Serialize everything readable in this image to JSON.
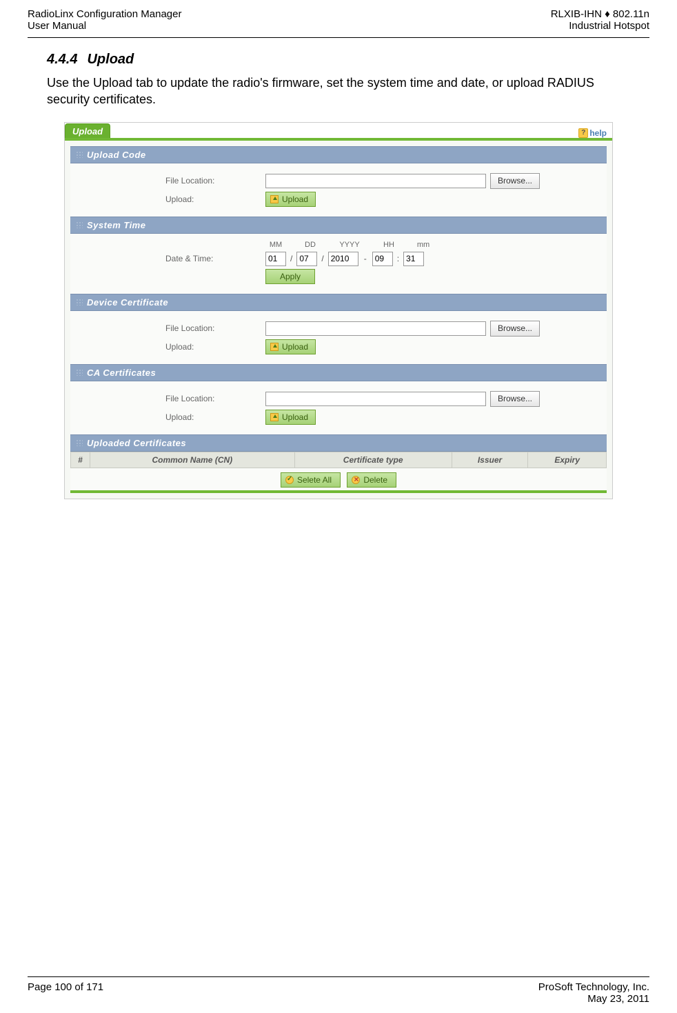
{
  "header": {
    "left_line1": "RadioLinx Configuration Manager",
    "left_line2": "User Manual",
    "right_line1": "RLXIB-IHN ♦ 802.11n",
    "right_line2": "Industrial Hotspot"
  },
  "section": {
    "number": "4.4.4",
    "title": "Upload",
    "paragraph": "Use the Upload tab to update the radio's firmware, set the system time and date, or upload RADIUS security certificates."
  },
  "ui": {
    "tab_label": "Upload",
    "help_label": "help",
    "panels": {
      "upload_code": {
        "title": "Upload Code",
        "file_location_label": "File Location:",
        "upload_label": "Upload:",
        "browse_btn": "Browse...",
        "upload_btn": "Upload"
      },
      "system_time": {
        "title": "System Time",
        "datetime_label": "Date & Time:",
        "cols": {
          "mm": "MM",
          "dd": "DD",
          "yyyy": "YYYY",
          "hh": "HH",
          "mn": "mm"
        },
        "vals": {
          "mm": "01",
          "dd": "07",
          "yyyy": "2010",
          "hh": "09",
          "mn": "31"
        },
        "apply_btn": "Apply"
      },
      "device_cert": {
        "title": "Device Certificate",
        "file_location_label": "File Location:",
        "upload_label": "Upload:",
        "browse_btn": "Browse...",
        "upload_btn": "Upload"
      },
      "ca_cert": {
        "title": "CA Certificates",
        "file_location_label": "File Location:",
        "upload_label": "Upload:",
        "browse_btn": "Browse...",
        "upload_btn": "Upload"
      },
      "uploaded_certs": {
        "title": "Uploaded Certificates",
        "cols": {
          "num": "#",
          "cn": "Common Name (CN)",
          "type": "Certificate type",
          "issuer": "Issuer",
          "expiry": "Expiry"
        },
        "select_all_btn": "Selete All",
        "delete_btn": "Delete"
      }
    }
  },
  "footer": {
    "page": "Page 100 of 171",
    "company": "ProSoft Technology, Inc.",
    "date": "May 23, 2011"
  }
}
